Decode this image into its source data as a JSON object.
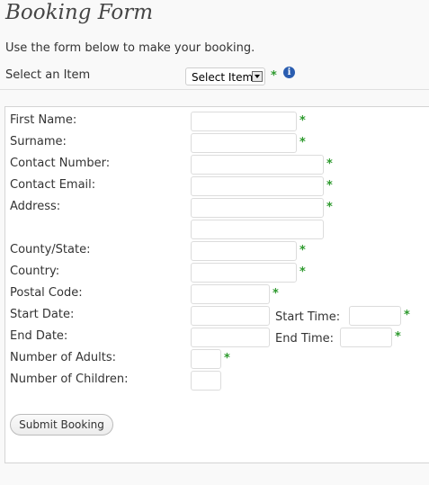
{
  "header": {
    "title": "Booking Form",
    "intro": "Use the form below to make your booking."
  },
  "item_select": {
    "label": "Select an Item",
    "value": "Select Item",
    "required_mark": "*",
    "info_icon": "i"
  },
  "fields": {
    "first_name": "First Name:",
    "surname": "Surname:",
    "contact_number": "Contact Number:",
    "contact_email": "Contact Email:",
    "address": "Address:",
    "county_state": "County/State:",
    "country": "Country:",
    "postal_code": "Postal Code:",
    "start_date": "Start Date:",
    "start_time": "Start Time:",
    "end_date": "End Date:",
    "end_time": "End Time:",
    "adults": "Number of Adults:",
    "children": "Number of Children:"
  },
  "required_mark": "*",
  "submit_label": "Submit Booking",
  "colors": {
    "required": "#2e9a2e",
    "info": "#2a5db0"
  }
}
